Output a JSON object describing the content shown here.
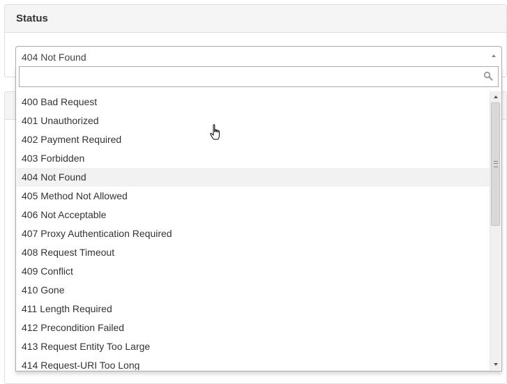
{
  "panel": {
    "title": "Status"
  },
  "select": {
    "selected": "404 Not Found"
  },
  "search": {
    "value": "",
    "placeholder": ""
  },
  "options": [
    "400 Bad Request",
    "401 Unauthorized",
    "402 Payment Required",
    "403 Forbidden",
    "404 Not Found",
    "405 Method Not Allowed",
    "406 Not Acceptable",
    "407 Proxy Authentication Required",
    "408 Request Timeout",
    "409 Conflict",
    "410 Gone",
    "411 Length Required",
    "412 Precondition Failed",
    "413 Request Entity Too Large",
    "414 Request-URI Too Long"
  ],
  "highlighted_index": 4,
  "icons": {
    "search": "search-icon",
    "cursor": "hand-cursor-icon",
    "arrow": "caret-up-icon"
  },
  "colors": {
    "highlight": "#f2f2f2",
    "border": "#aaaaaa",
    "heading_bg": "#f5f5f5"
  }
}
